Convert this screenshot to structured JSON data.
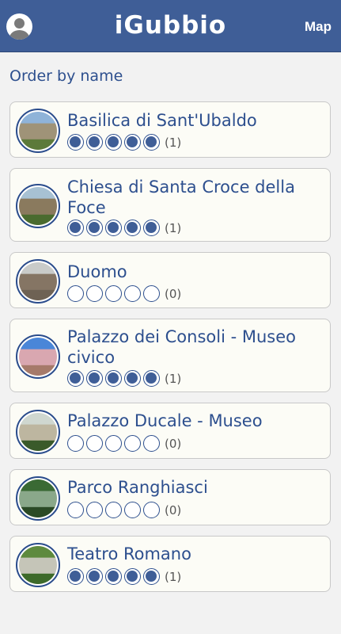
{
  "header": {
    "logo": "iGubbio",
    "map_label": "Map",
    "avatar_icon": "user-avatar-icon"
  },
  "order_label": "Order by name",
  "places": [
    {
      "name": "Basilica di Sant'Ubaldo",
      "rating": 5,
      "count": "(1)",
      "thumb": [
        "#8fb3d8",
        "#9f9378",
        "#5c7a3a"
      ]
    },
    {
      "name": "Chiesa di Santa Croce della Foce",
      "rating": 5,
      "count": "(1)",
      "thumb": [
        "#a7c1d3",
        "#8a7a5e",
        "#4a6b2f"
      ]
    },
    {
      "name": "Duomo",
      "rating": 0,
      "count": "(0)",
      "thumb": [
        "#c9cbc9",
        "#857564",
        "#6e6254"
      ]
    },
    {
      "name": "Palazzo dei Consoli - Museo civico",
      "rating": 5,
      "count": "(1)",
      "thumb": [
        "#4a86d8",
        "#d9a7b0",
        "#a67a6a"
      ]
    },
    {
      "name": "Palazzo Ducale - Museo",
      "rating": 0,
      "count": "(0)",
      "thumb": [
        "#cfd7d0",
        "#bdb6a0",
        "#3a5a2a"
      ]
    },
    {
      "name": "Parco Ranghiasci",
      "rating": 0,
      "count": "(0)",
      "thumb": [
        "#3a6a34",
        "#8aa88a",
        "#2b4a26"
      ]
    },
    {
      "name": "Teatro Romano",
      "rating": 5,
      "count": "(1)",
      "thumb": [
        "#5e8a3e",
        "#c5c5b8",
        "#3d6a2a"
      ]
    }
  ]
}
